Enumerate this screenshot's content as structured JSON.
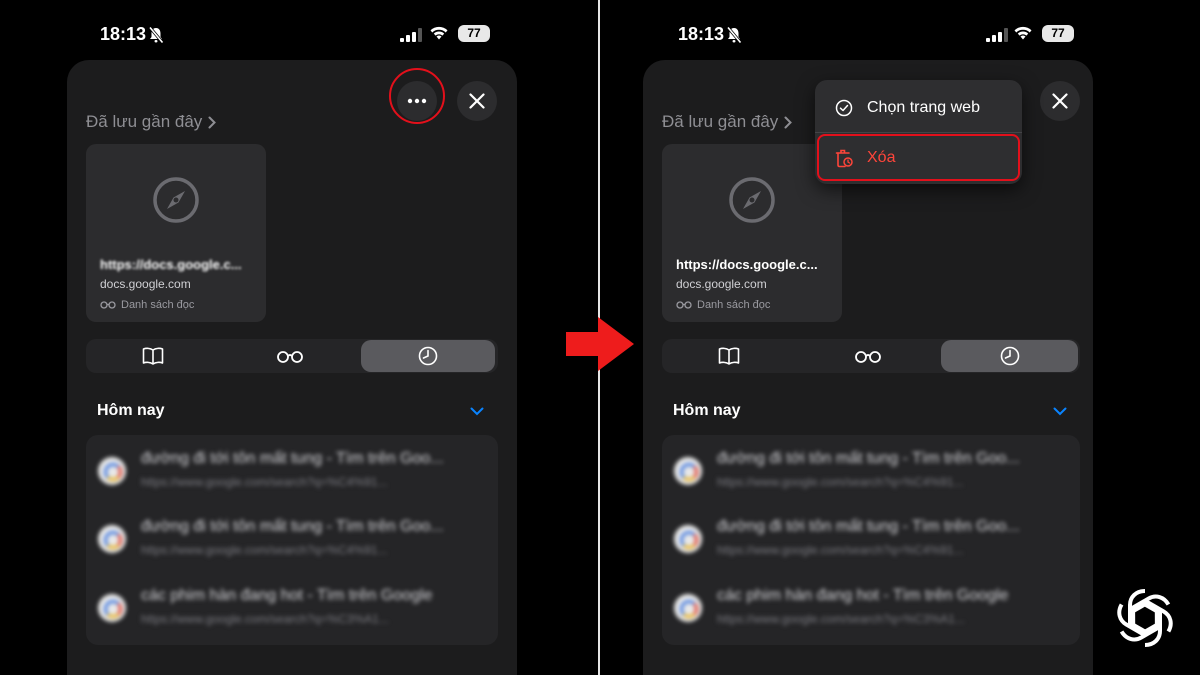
{
  "status": {
    "time": "18:13",
    "battery": "77"
  },
  "left": {
    "section_title": "Đã lưu gần đây",
    "card": {
      "title": "https://docs.google.c...",
      "domain": "docs.google.com",
      "reading_list": "Danh sách đọc"
    },
    "today_label": "Hôm nay"
  },
  "right": {
    "section_title": "Đã lưu gần đây",
    "card": {
      "title": "https://docs.google.c...",
      "domain": "docs.google.com",
      "reading_list": "Danh sách đọc"
    },
    "today_label": "Hôm nay",
    "menu": {
      "select_label": "Chọn trang web",
      "delete_label": "Xóa"
    }
  },
  "history": [
    {
      "title": "đường đi tới tôn mất tung - Tìm trên Goo...",
      "url": "https://www.google.com/search?q=%C4%91..."
    },
    {
      "title": "đường đi tới tôn mất tung - Tìm trên Goo...",
      "url": "https://www.google.com/search?q=%C4%91..."
    },
    {
      "title": "các phim hàn đang hot - Tìm trên Google",
      "url": "https://www.google.com/search?q=%C3%A1..."
    }
  ],
  "colors": {
    "highlight": "#e3101b",
    "delete_text": "#ff453a",
    "accent_blue": "#0a84ff"
  },
  "icons": [
    "bell-slash-icon",
    "signal-icon",
    "wifi-icon",
    "battery-icon",
    "more-icon",
    "close-icon",
    "chevron-right-icon",
    "compass-icon",
    "glasses-icon",
    "book-icon",
    "clock-icon",
    "chevron-down-icon",
    "google-icon",
    "checkmark-circle-icon",
    "trash-clock-icon",
    "arrow-right-icon",
    "openai-logo-icon"
  ]
}
